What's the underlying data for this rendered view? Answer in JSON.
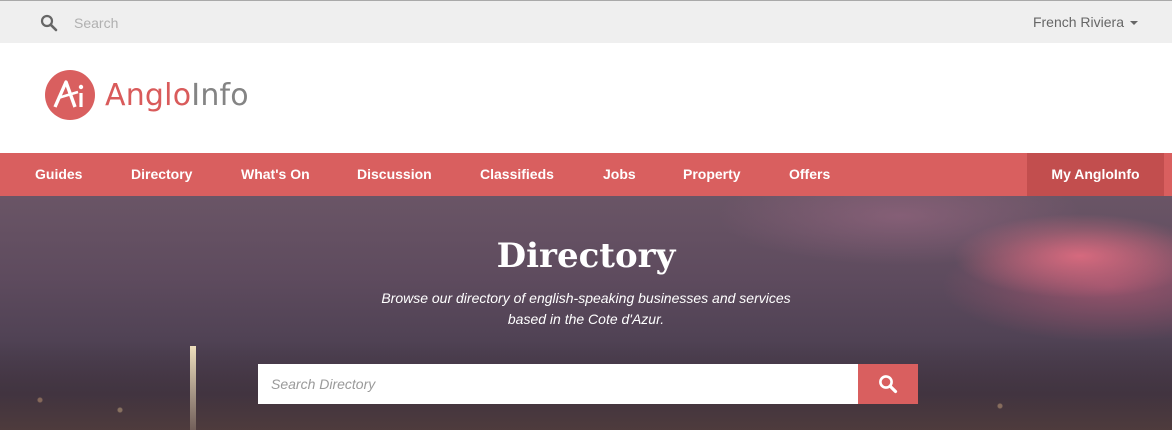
{
  "topbar": {
    "search_placeholder": "Search",
    "region_label": "French Riviera"
  },
  "logo": {
    "anglo": "Anglo",
    "info": "Info",
    "mark_letters": "Ai"
  },
  "nav": {
    "items": [
      {
        "label": "Guides"
      },
      {
        "label": "Directory"
      },
      {
        "label": "What's On"
      },
      {
        "label": "Discussion"
      },
      {
        "label": "Classifieds"
      },
      {
        "label": "Jobs"
      },
      {
        "label": "Property"
      },
      {
        "label": "Offers"
      }
    ],
    "my_label": "My AngloInfo"
  },
  "hero": {
    "title": "Directory",
    "subtitle_line1": "Browse our directory of english-speaking businesses and services",
    "subtitle_line2": "based in the Cote d'Azur.",
    "search_placeholder": "Search Directory"
  },
  "colors": {
    "brand_red": "#d95f5f",
    "brand_red_dark": "#c24e4e",
    "logo_gray": "#848484"
  }
}
